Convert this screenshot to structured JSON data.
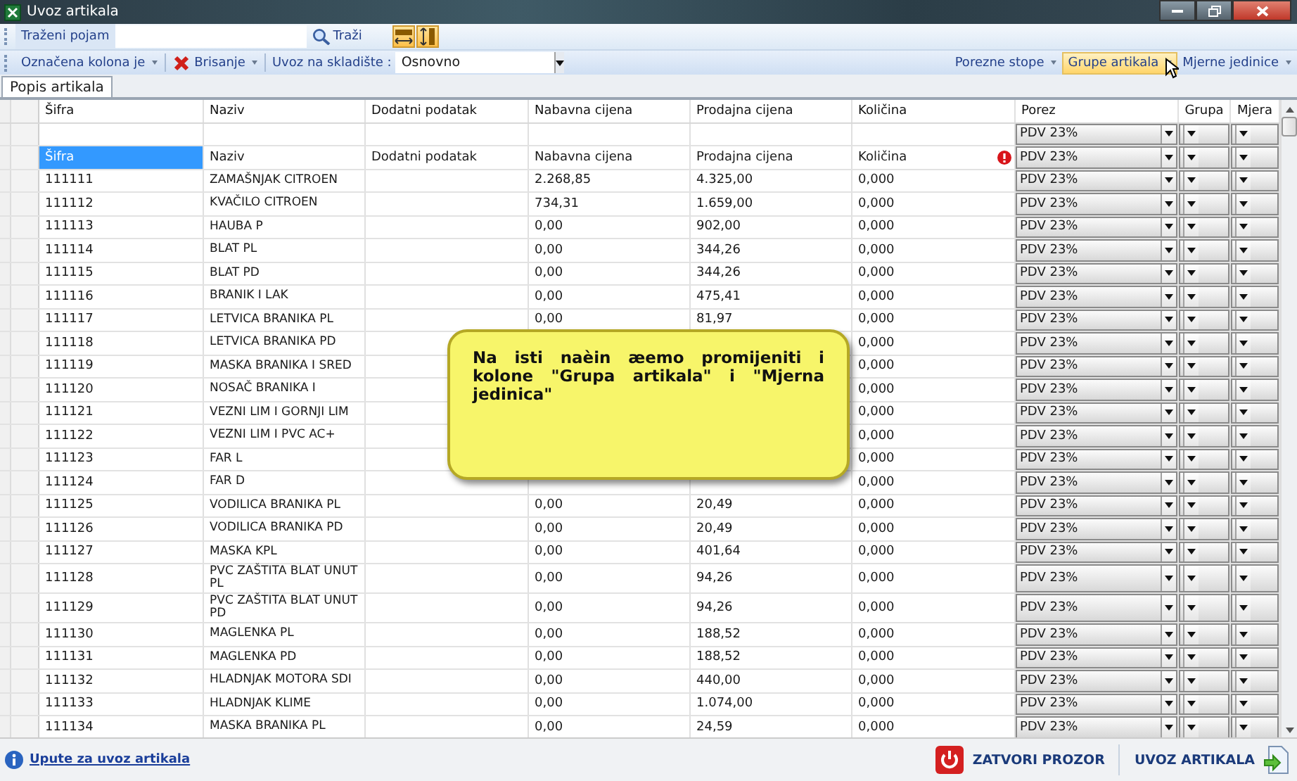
{
  "window": {
    "title": "Uvoz artikala"
  },
  "search_toolbar": {
    "label": "Traženi pojam",
    "search_button": "Traži"
  },
  "toolbar": {
    "marked_column_menu": "Označena kolona je",
    "delete_menu": "Brisanje",
    "warehouse_label": "Uvoz na skladište :",
    "warehouse_value": "Osnovno",
    "right_menus": [
      {
        "label": "Porezne stope",
        "selected": false
      },
      {
        "label": "Grupe artikala",
        "selected": true
      },
      {
        "label": "Mjerne jedinice",
        "selected": false
      }
    ]
  },
  "tabs": [
    {
      "label": "Popis artikala",
      "selected": true
    }
  ],
  "table": {
    "columns": [
      "Šifra",
      "Naziv",
      "Dodatni podatak",
      "Nabavna cijena",
      "Prodajna cijena",
      "Količina",
      "Porez",
      "Grupa",
      "Mjera"
    ],
    "filter_row": {
      "porez": "PDV 23%"
    },
    "mapping_row": {
      "cells": [
        {
          "text": "Šifra",
          "selected": true,
          "error": false
        },
        {
          "text": "Naziv",
          "selected": false,
          "error": false
        },
        {
          "text": "Dodatni podatak",
          "selected": false,
          "error": false
        },
        {
          "text": "Nabavna cijena",
          "selected": false,
          "error": false
        },
        {
          "text": "Prodajna cijena",
          "selected": false,
          "error": false
        },
        {
          "text": "Količina",
          "selected": false,
          "error": true
        }
      ],
      "porez": "PDV 23%"
    },
    "rows": [
      {
        "sifra": "111111",
        "naziv": "ZAMAŠNJAK CITROEN",
        "nabavna": "2.268,85",
        "prodajna": "4.325,00",
        "kolicina": "0,000",
        "porez": "PDV 23%"
      },
      {
        "sifra": "111112",
        "naziv": "KVAČILO CITROEN",
        "nabavna": "734,31",
        "prodajna": "1.659,00",
        "kolicina": "0,000",
        "porez": "PDV 23%"
      },
      {
        "sifra": "111113",
        "naziv": "HAUBA P",
        "nabavna": "0,00",
        "prodajna": "902,00",
        "kolicina": "0,000",
        "porez": "PDV 23%"
      },
      {
        "sifra": "111114",
        "naziv": "BLAT PL",
        "nabavna": "0,00",
        "prodajna": "344,26",
        "kolicina": "0,000",
        "porez": "PDV 23%"
      },
      {
        "sifra": "111115",
        "naziv": "BLAT PD",
        "nabavna": "0,00",
        "prodajna": "344,26",
        "kolicina": "0,000",
        "porez": "PDV 23%"
      },
      {
        "sifra": "111116",
        "naziv": "BRANIK I LAK",
        "nabavna": "0,00",
        "prodajna": "475,41",
        "kolicina": "0,000",
        "porez": "PDV 23%"
      },
      {
        "sifra": "111117",
        "naziv": "LETVICA BRANIKA PL",
        "nabavna": "0,00",
        "prodajna": "81,97",
        "kolicina": "0,000",
        "porez": "PDV 23%"
      },
      {
        "sifra": "111118",
        "naziv": "LETVICA BRANIKA PD",
        "kolicina": "0,000",
        "porez": "PDV 23%"
      },
      {
        "sifra": "111119",
        "naziv": "MASKA BRANIKA I SRED",
        "kolicina": "0,000",
        "porez": "PDV 23%"
      },
      {
        "sifra": "111120",
        "naziv": "NOSAČ BRANIKA I",
        "kolicina": "0,000",
        "porez": "PDV 23%"
      },
      {
        "sifra": "111121",
        "naziv": "VEZNI LIM I GORNJI LIM",
        "kolicina": "0,000",
        "porez": "PDV 23%"
      },
      {
        "sifra": "111122",
        "naziv": "VEZNI LIM I PVC AC+",
        "kolicina": "0,000",
        "porez": "PDV 23%"
      },
      {
        "sifra": "111123",
        "naziv": "FAR L",
        "kolicina": "0,000",
        "porez": "PDV 23%"
      },
      {
        "sifra": "111124",
        "naziv": "FAR D",
        "kolicina": "0,000",
        "porez": "PDV 23%"
      },
      {
        "sifra": "111125",
        "naziv": "VODILICA BRANIKA PL",
        "nabavna": "0,00",
        "prodajna": "20,49",
        "kolicina": "0,000",
        "porez": "PDV 23%"
      },
      {
        "sifra": "111126",
        "naziv": "VODILICA BRANIKA PD",
        "nabavna": "0,00",
        "prodajna": "20,49",
        "kolicina": "0,000",
        "porez": "PDV 23%"
      },
      {
        "sifra": "111127",
        "naziv": "MASKA KPL",
        "nabavna": "0,00",
        "prodajna": "401,64",
        "kolicina": "0,000",
        "porez": "PDV 23%"
      },
      {
        "sifra": "111128",
        "naziv": "PVC ZAŠTITA BLAT UNUT PL",
        "nabavna": "0,00",
        "prodajna": "94,26",
        "kolicina": "0,000",
        "porez": "PDV 23%"
      },
      {
        "sifra": "111129",
        "naziv": "PVC ZAŠTITA BLAT UNUT PD",
        "nabavna": "0,00",
        "prodajna": "94,26",
        "kolicina": "0,000",
        "porez": "PDV 23%"
      },
      {
        "sifra": "111130",
        "naziv": "MAGLENKA PL",
        "nabavna": "0,00",
        "prodajna": "188,52",
        "kolicina": "0,000",
        "porez": "PDV 23%"
      },
      {
        "sifra": "111131",
        "naziv": "MAGLENKA PD",
        "nabavna": "0,00",
        "prodajna": "188,52",
        "kolicina": "0,000",
        "porez": "PDV 23%"
      },
      {
        "sifra": "111132",
        "naziv": "HLADNJAK MOTORA SDI",
        "nabavna": "0,00",
        "prodajna": "440,00",
        "kolicina": "0,000",
        "porez": "PDV 23%"
      },
      {
        "sifra": "111133",
        "naziv": "HLADNJAK KLIME",
        "nabavna": "0,00",
        "prodajna": "1.074,00",
        "kolicina": "0,000",
        "porez": "PDV 23%"
      },
      {
        "sifra": "111134",
        "naziv": "MASKA BRANIKA PL",
        "nabavna": "0,00",
        "prodajna": "24,59",
        "kolicina": "0,000",
        "porez": "PDV 23%"
      }
    ]
  },
  "callout": {
    "text": "Na isti naèin æemo promijeniti i kolone \"Grupa artikala\" i \"Mjerna jedinica\""
  },
  "footer": {
    "help_link": "Upute za uvoz artikala",
    "close_button": "ZATVORI PROZOR",
    "import_button": "UVOZ ARTIKALA"
  }
}
